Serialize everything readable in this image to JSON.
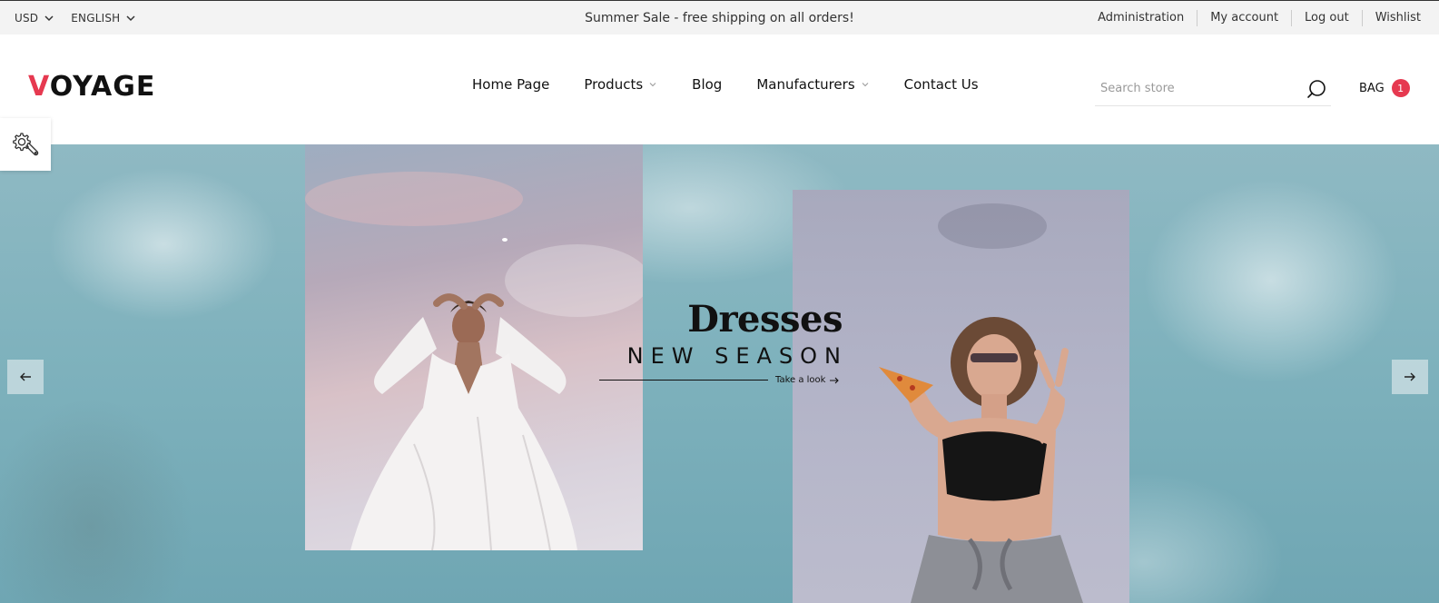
{
  "topbar": {
    "currency": "USD",
    "language": "ENGLISH",
    "promo": "Summer Sale - free shipping on all orders!",
    "links": [
      "Administration",
      "My account",
      "Log out",
      "Wishlist"
    ]
  },
  "header": {
    "logo_first": "V",
    "logo_rest": "OYAGE",
    "nav": [
      {
        "label": "Home Page",
        "dropdown": false
      },
      {
        "label": "Products",
        "dropdown": true
      },
      {
        "label": "Blog",
        "dropdown": false
      },
      {
        "label": "Manufacturers",
        "dropdown": true
      },
      {
        "label": "Contact Us",
        "dropdown": false
      }
    ],
    "search_placeholder": "Search store",
    "bag_label": "BAG",
    "bag_count": "1"
  },
  "hero": {
    "title": "Dresses",
    "subtitle": "NEW SEASON",
    "cta": "Take a look"
  },
  "icons": {
    "search": "search-icon",
    "settings": "wrench-gear-icon",
    "prev": "arrow-left-icon",
    "next": "arrow-right-icon"
  },
  "colors": {
    "accent": "#e63950",
    "topbar_bg": "#f3f3f3",
    "sky": "#7fb2bd"
  }
}
